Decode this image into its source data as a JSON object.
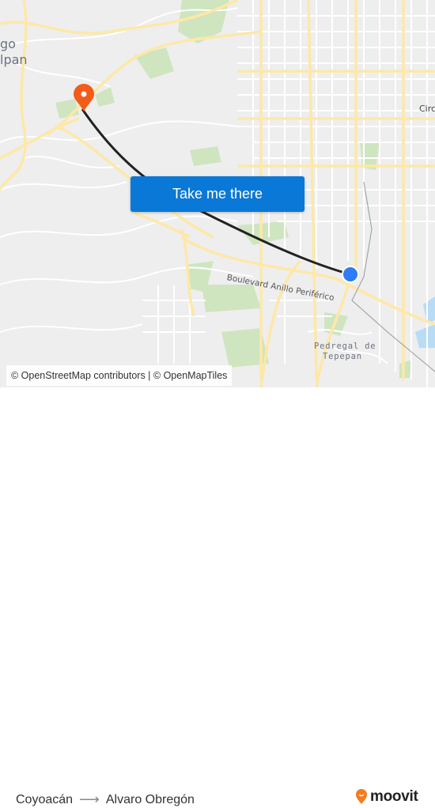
{
  "map": {
    "labels": {
      "city_top_left_1": "go",
      "city_top_left_2": "lpan",
      "circuito": "Circu",
      "boulevard": "Boulevard Anillo Periférico",
      "pedregal_1": "Pedregal de",
      "pedregal_2": "Tepepan"
    },
    "origin_marker_color": "#2f7cf6",
    "destination_marker_color": "#f25c19",
    "route_color": "#222222"
  },
  "cta": {
    "label": "Take me there",
    "color": "#0a78d6"
  },
  "attribution": {
    "text": "© OpenStreetMap contributors | © OpenMapTiles"
  },
  "footer": {
    "origin": "Coyoacán",
    "arrow": "⟶",
    "destination": "Alvaro Obregón",
    "brand": "moovit",
    "brand_color": "#f47b20"
  }
}
